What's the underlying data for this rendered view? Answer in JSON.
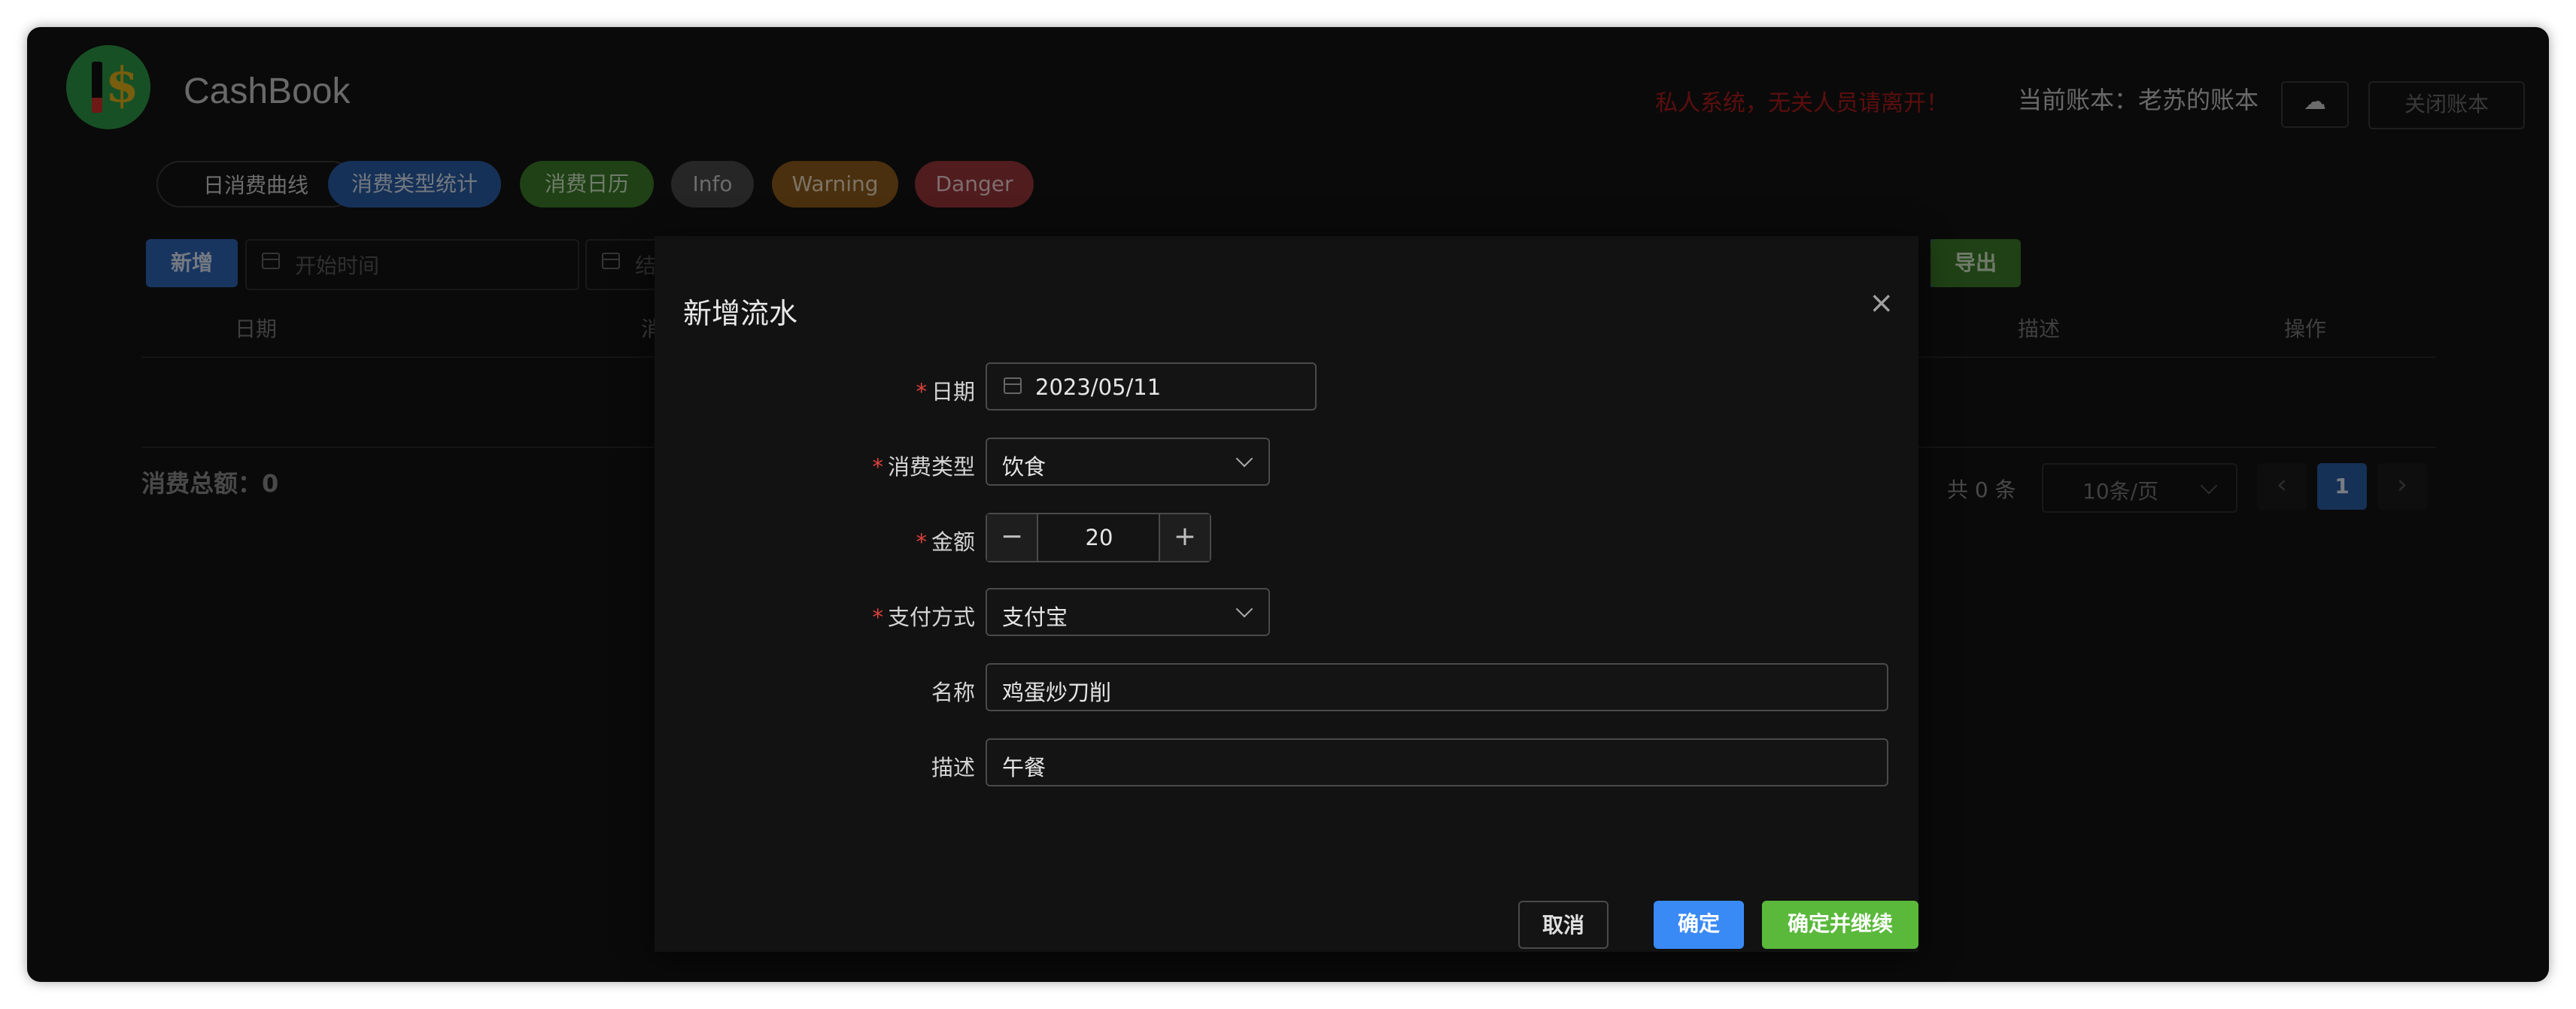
{
  "app": {
    "title": "CashBook"
  },
  "header": {
    "warning": "私人系统，无关人员请离开！",
    "account": "当前账本：老苏的账本",
    "cloud_icon": "☁",
    "close_account": "关闭账本"
  },
  "tags": [
    {
      "label": "日消费曲线",
      "color": "#141414"
    },
    {
      "label": "消费类型统计",
      "color": "#2b5fa8"
    },
    {
      "label": "消费日历",
      "color": "#3d7d2a"
    },
    {
      "label": "Info",
      "color": "#4a4a4a"
    },
    {
      "label": "Warning",
      "color": "#8f5c1c"
    },
    {
      "label": "Danger",
      "color": "#9a363a"
    }
  ],
  "toolbar": {
    "add": "新增",
    "start_placeholder": "开始时间",
    "end_placeholder": "结",
    "export": "导出"
  },
  "table": {
    "columns": [
      "日期",
      "消",
      "描述",
      "操作"
    ]
  },
  "summary": {
    "total": "消费总额：0"
  },
  "pagination": {
    "total": "共 0 条",
    "page_size": "10条/页",
    "current": "1",
    "prev_icon": "‹",
    "next_icon": "›"
  },
  "dialog": {
    "title": "新增流水",
    "close_icon": "×",
    "fields": {
      "date": {
        "label": "日期",
        "value": "2023/05/11",
        "required": true
      },
      "type": {
        "label": "消费类型",
        "value": "饮食",
        "required": true
      },
      "amount": {
        "label": "金额",
        "value": "20",
        "minus": "−",
        "plus": "+",
        "required": true
      },
      "payment": {
        "label": "支付方式",
        "value": "支付宝",
        "required": true
      },
      "name": {
        "label": "名称",
        "value": "鸡蛋炒刀削"
      },
      "desc": {
        "label": "描述",
        "value": "午餐"
      }
    },
    "required_mark": "*",
    "buttons": {
      "cancel": "取消",
      "ok": "确定",
      "ok_continue": "确定并继续"
    }
  },
  "colors": {
    "primary": "#3a8af5",
    "success": "#5ab93b",
    "danger": "#b01c1c"
  }
}
